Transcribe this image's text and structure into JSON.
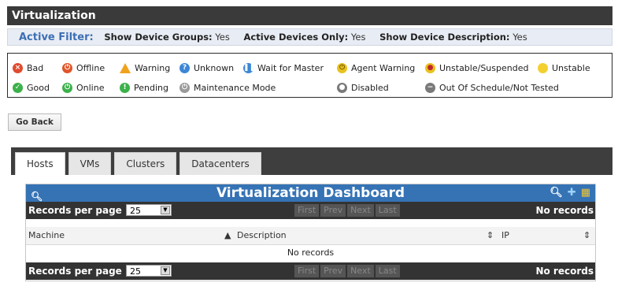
{
  "title": "Virtualization",
  "filter": {
    "label": "Active Filter:",
    "items": [
      {
        "key": "Show Device Groups:",
        "value": "Yes"
      },
      {
        "key": "Active Devices Only:",
        "value": "Yes"
      },
      {
        "key": "Show Device Description:",
        "value": "Yes"
      }
    ]
  },
  "legend": [
    {
      "label": "Bad",
      "icon": "bad-icon",
      "color": "#e04b2f"
    },
    {
      "label": "Offline",
      "icon": "offline-icon",
      "color": "#e0552a"
    },
    {
      "label": "Warning",
      "icon": "warning-icon",
      "color": "#f0a21d"
    },
    {
      "label": "Unknown",
      "icon": "unknown-icon",
      "color": "#3c86d6"
    },
    {
      "label": "Wait for Master",
      "icon": "wait-icon",
      "color": "#3c86d6"
    },
    {
      "label": "Agent Warning",
      "icon": "agent-warning-icon",
      "color": "#e8c21e"
    },
    {
      "label": "Unstable/Suspended",
      "icon": "unstable-suspended-icon",
      "color": "#e8c21e"
    },
    {
      "label": "Unstable",
      "icon": "unstable-icon",
      "color": "#f3d030"
    },
    {
      "label": "Good",
      "icon": "good-icon",
      "color": "#3bb14a"
    },
    {
      "label": "Online",
      "icon": "online-icon",
      "color": "#3bb14a"
    },
    {
      "label": "Pending",
      "icon": "pending-icon",
      "color": "#3bb14a"
    },
    {
      "label": "Maintenance Mode",
      "icon": "maintenance-icon",
      "color": "#9a9a9a"
    },
    {
      "label": "Disabled",
      "icon": "disabled-icon",
      "color": "#7a7a7a"
    },
    {
      "label": "Out Of Schedule/Not Tested",
      "icon": "out-of-schedule-icon",
      "color": "#7a7a7a"
    }
  ],
  "go_back": "Go Back",
  "tabs": [
    "Hosts",
    "VMs",
    "Clusters",
    "Datacenters"
  ],
  "dashboard": {
    "title": "Virtualization Dashboard",
    "records_per_page_label": "Records per page",
    "records_per_page_value": "25",
    "pager": [
      "First",
      "Prev",
      "Next",
      "Last"
    ],
    "no_records": "No records",
    "columns": [
      "Machine",
      "Description",
      "IP"
    ],
    "empty_text": "No records"
  }
}
